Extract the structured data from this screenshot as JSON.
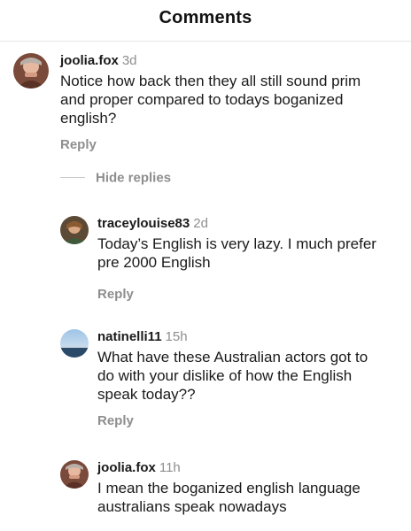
{
  "header": {
    "title": "Comments"
  },
  "comments": [
    {
      "username": "joolia.fox",
      "time": "3d",
      "text_lines": [
        "Notice how back then they all still sound prim",
        "and proper compared to todays boganized",
        "english?"
      ],
      "reply_label": "Reply",
      "avatar_icon": "avatar-photo-person"
    }
  ],
  "hide_replies_label": "Hide replies",
  "replies": [
    {
      "username": "traceylouise83",
      "time": "2d",
      "text_lines": [
        "Today’s English is very lazy. I much prefer",
        "pre 2000 English"
      ],
      "reply_label": "Reply",
      "avatar_icon": "avatar-photo-person"
    },
    {
      "username": "natinelli11",
      "time": "15h",
      "text_lines": [
        "What have these Australian actors got to",
        "do with your dislike of how the English",
        "speak today??"
      ],
      "reply_label": "Reply",
      "avatar_icon": "avatar-photo-landscape"
    },
    {
      "username": "joolia.fox",
      "time": "11h",
      "text_lines": [
        "I mean the boganized english language",
        "australians speak nowadays"
      ],
      "avatar_icon": "avatar-photo-person"
    }
  ],
  "colors": {
    "text_primary": "#1a1a1a",
    "text_secondary": "#8e8e8e",
    "divider": "#e6e6e6"
  }
}
